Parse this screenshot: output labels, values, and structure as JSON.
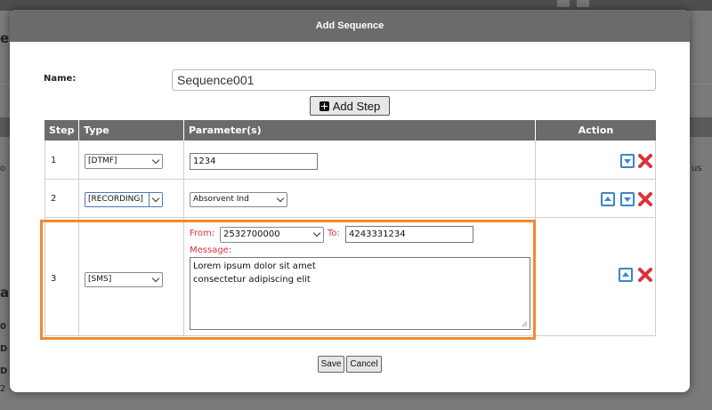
{
  "modal": {
    "title": "Add Sequence",
    "name_label": "Name:",
    "name_value": "Sequence001",
    "add_step_label": "Add Step",
    "save_label": "Save",
    "cancel_label": "Cancel"
  },
  "table": {
    "headers": {
      "step": "Step",
      "type": "Type",
      "params": "Parameter(s)",
      "action": "Action"
    },
    "rows": [
      {
        "step": "1",
        "type": "[DTMF]",
        "param": "1234"
      },
      {
        "step": "2",
        "type": "[RECORDING]",
        "param": "Absorvent Ind"
      },
      {
        "step": "3",
        "type": "[SMS]",
        "from_label": "From:",
        "from_value": "2532700000",
        "to_label": "To:",
        "to_value": "4243331234",
        "message_label": "Message:",
        "message_line1": "Lorem ipsum dolor sit amet",
        "message_line2": "consectetur adipiscing elit"
      }
    ]
  },
  "colors": {
    "header_bg": "#6b6b6b",
    "highlight": "#f28a2b",
    "delete_red": "#d9343a",
    "arrow_blue": "#3a86c8"
  },
  "icons": [
    "plus-square-icon",
    "move-down-icon",
    "move-up-icon",
    "delete-icon",
    "dropdown-chevron-icon",
    "resize-handle-icon"
  ]
}
